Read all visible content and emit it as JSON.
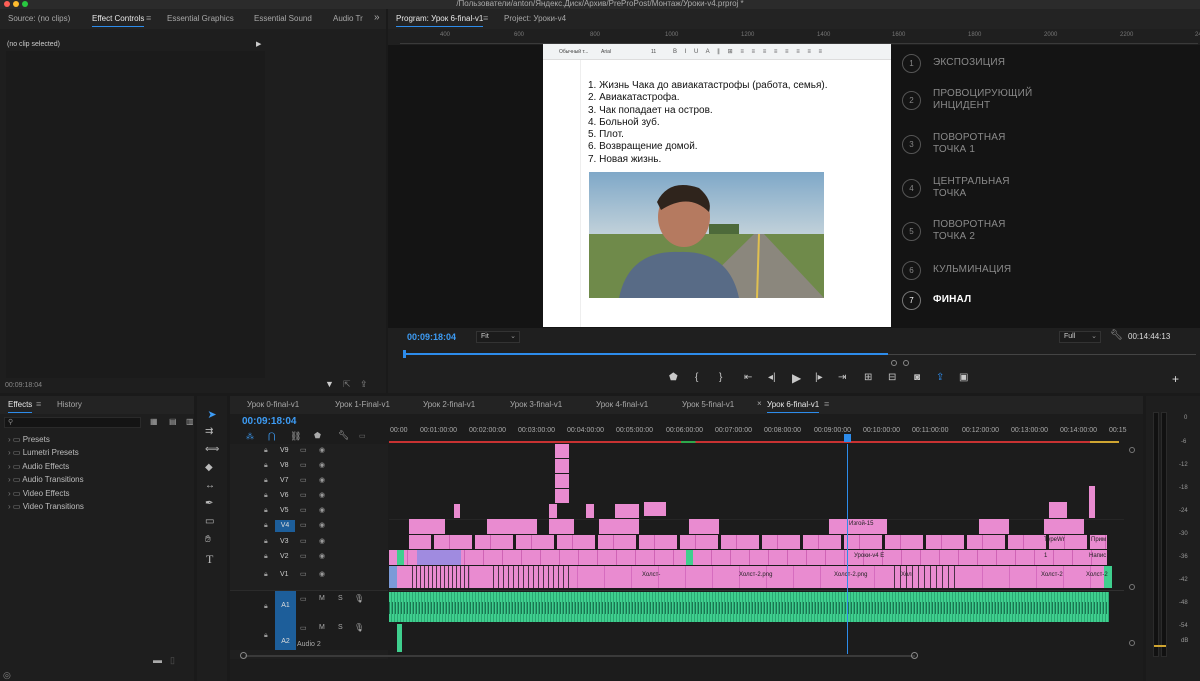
{
  "window": {
    "title": "/Пользователи/anton/Яндекс.Диск/Архив/PreProPost/Монтаж/Уроки-v4.prproj *"
  },
  "colors": {
    "accent": "#2d8ceb",
    "clip_pink": "#e98bd0",
    "clip_green": "#3fcf8e",
    "playhead": "#2d8ceb"
  },
  "top_left_panel": {
    "tabs": [
      "Source: (no clips)",
      "Effect Controls",
      "Essential Graphics",
      "Essential Sound",
      "Audio Tr"
    ],
    "no_clip": "(no clip selected)",
    "timecode": "00:09:18:04"
  },
  "program": {
    "tab_label": "Program: Урок 6-final-v1",
    "project_tab": "Project: Уроки-v4",
    "timecode": "00:09:18:04",
    "fit": "Fit",
    "quality": "Full",
    "duration": "00:14:44:13",
    "ruler_ticks": [
      "400",
      "600",
      "800",
      "1000",
      "1200",
      "1400",
      "1600",
      "1800",
      "2000",
      "2200",
      "2400"
    ],
    "doc_toolbar": [
      "Обычный т...",
      "Arial",
      "11"
    ],
    "doc_list": [
      "1. Жизнь Чака до авиакатастрофы (работа, семья).",
      "2. Авиакатастрофа.",
      "3. Чак попадает на остров.",
      "4. Больной зуб.",
      "5. Плот.",
      "6. Возвращение домой.",
      "7. Новая жизнь."
    ],
    "beats": [
      {
        "n": "1",
        "label": "ЭКСПОЗИЦИЯ",
        "active": false
      },
      {
        "n": "2",
        "label": "ПРОВОЦИРУЮЩИЙ\nИНЦИДЕНТ",
        "active": false
      },
      {
        "n": "3",
        "label": "ПОВОРОТНАЯ\nТОЧКА 1",
        "active": false
      },
      {
        "n": "4",
        "label": "ЦЕНТРАЛЬНАЯ\nТОЧКА",
        "active": false
      },
      {
        "n": "5",
        "label": "ПОВОРОТНАЯ\nТОЧКА 2",
        "active": false
      },
      {
        "n": "6",
        "label": "КУЛЬМИНАЦИЯ",
        "active": false
      },
      {
        "n": "7",
        "label": "ФИНАЛ",
        "active": true
      }
    ]
  },
  "effects": {
    "tabs": [
      "Effects",
      "History"
    ],
    "items": [
      "Presets",
      "Lumetri Presets",
      "Audio Effects",
      "Audio Transitions",
      "Video Effects",
      "Video Transitions"
    ]
  },
  "timeline": {
    "tabs": [
      "Урок 0-final-v1",
      "Урок 1-Final-v1",
      "Урок 2-final-v1",
      "Урок 3-final-v1",
      "Урок 4-final-v1",
      "Урок 5-final-v1",
      "Урок 6-final-v1"
    ],
    "timecode": "00:09:18:04",
    "ruler": [
      "00:00",
      "00:01:00:00",
      "00:02:00:00",
      "00:03:00:00",
      "00:04:00:00",
      "00:05:00:00",
      "00:06:00:00",
      "00:07:00:00",
      "00:08:00:00",
      "00:09:00:00",
      "00:10:00:00",
      "00:11:00:00",
      "00:12:00:00",
      "00:13:00:00",
      "00:14:00:00",
      "00:15"
    ],
    "video_tracks": [
      "V9",
      "V8",
      "V7",
      "V6",
      "V5",
      "V4",
      "V3",
      "V2",
      "V1"
    ],
    "audio_tracks": [
      "A1",
      "A2"
    ],
    "audio2_name": "Audio 2",
    "clip_labels": [
      "Изгой-15",
      "Уроки-v4 E",
      "Холст-",
      "Холст-2.png",
      "Холст-2.png",
      "Хол",
      "Холст-2",
      "Холст-2",
      "TypeWr",
      "Прим",
      "Напис",
      "1"
    ]
  },
  "meter": {
    "scale": [
      "0",
      "-6",
      "-12",
      "-18",
      "-24",
      "-30",
      "-36",
      "-42",
      "-48",
      "-54",
      "dB"
    ]
  }
}
